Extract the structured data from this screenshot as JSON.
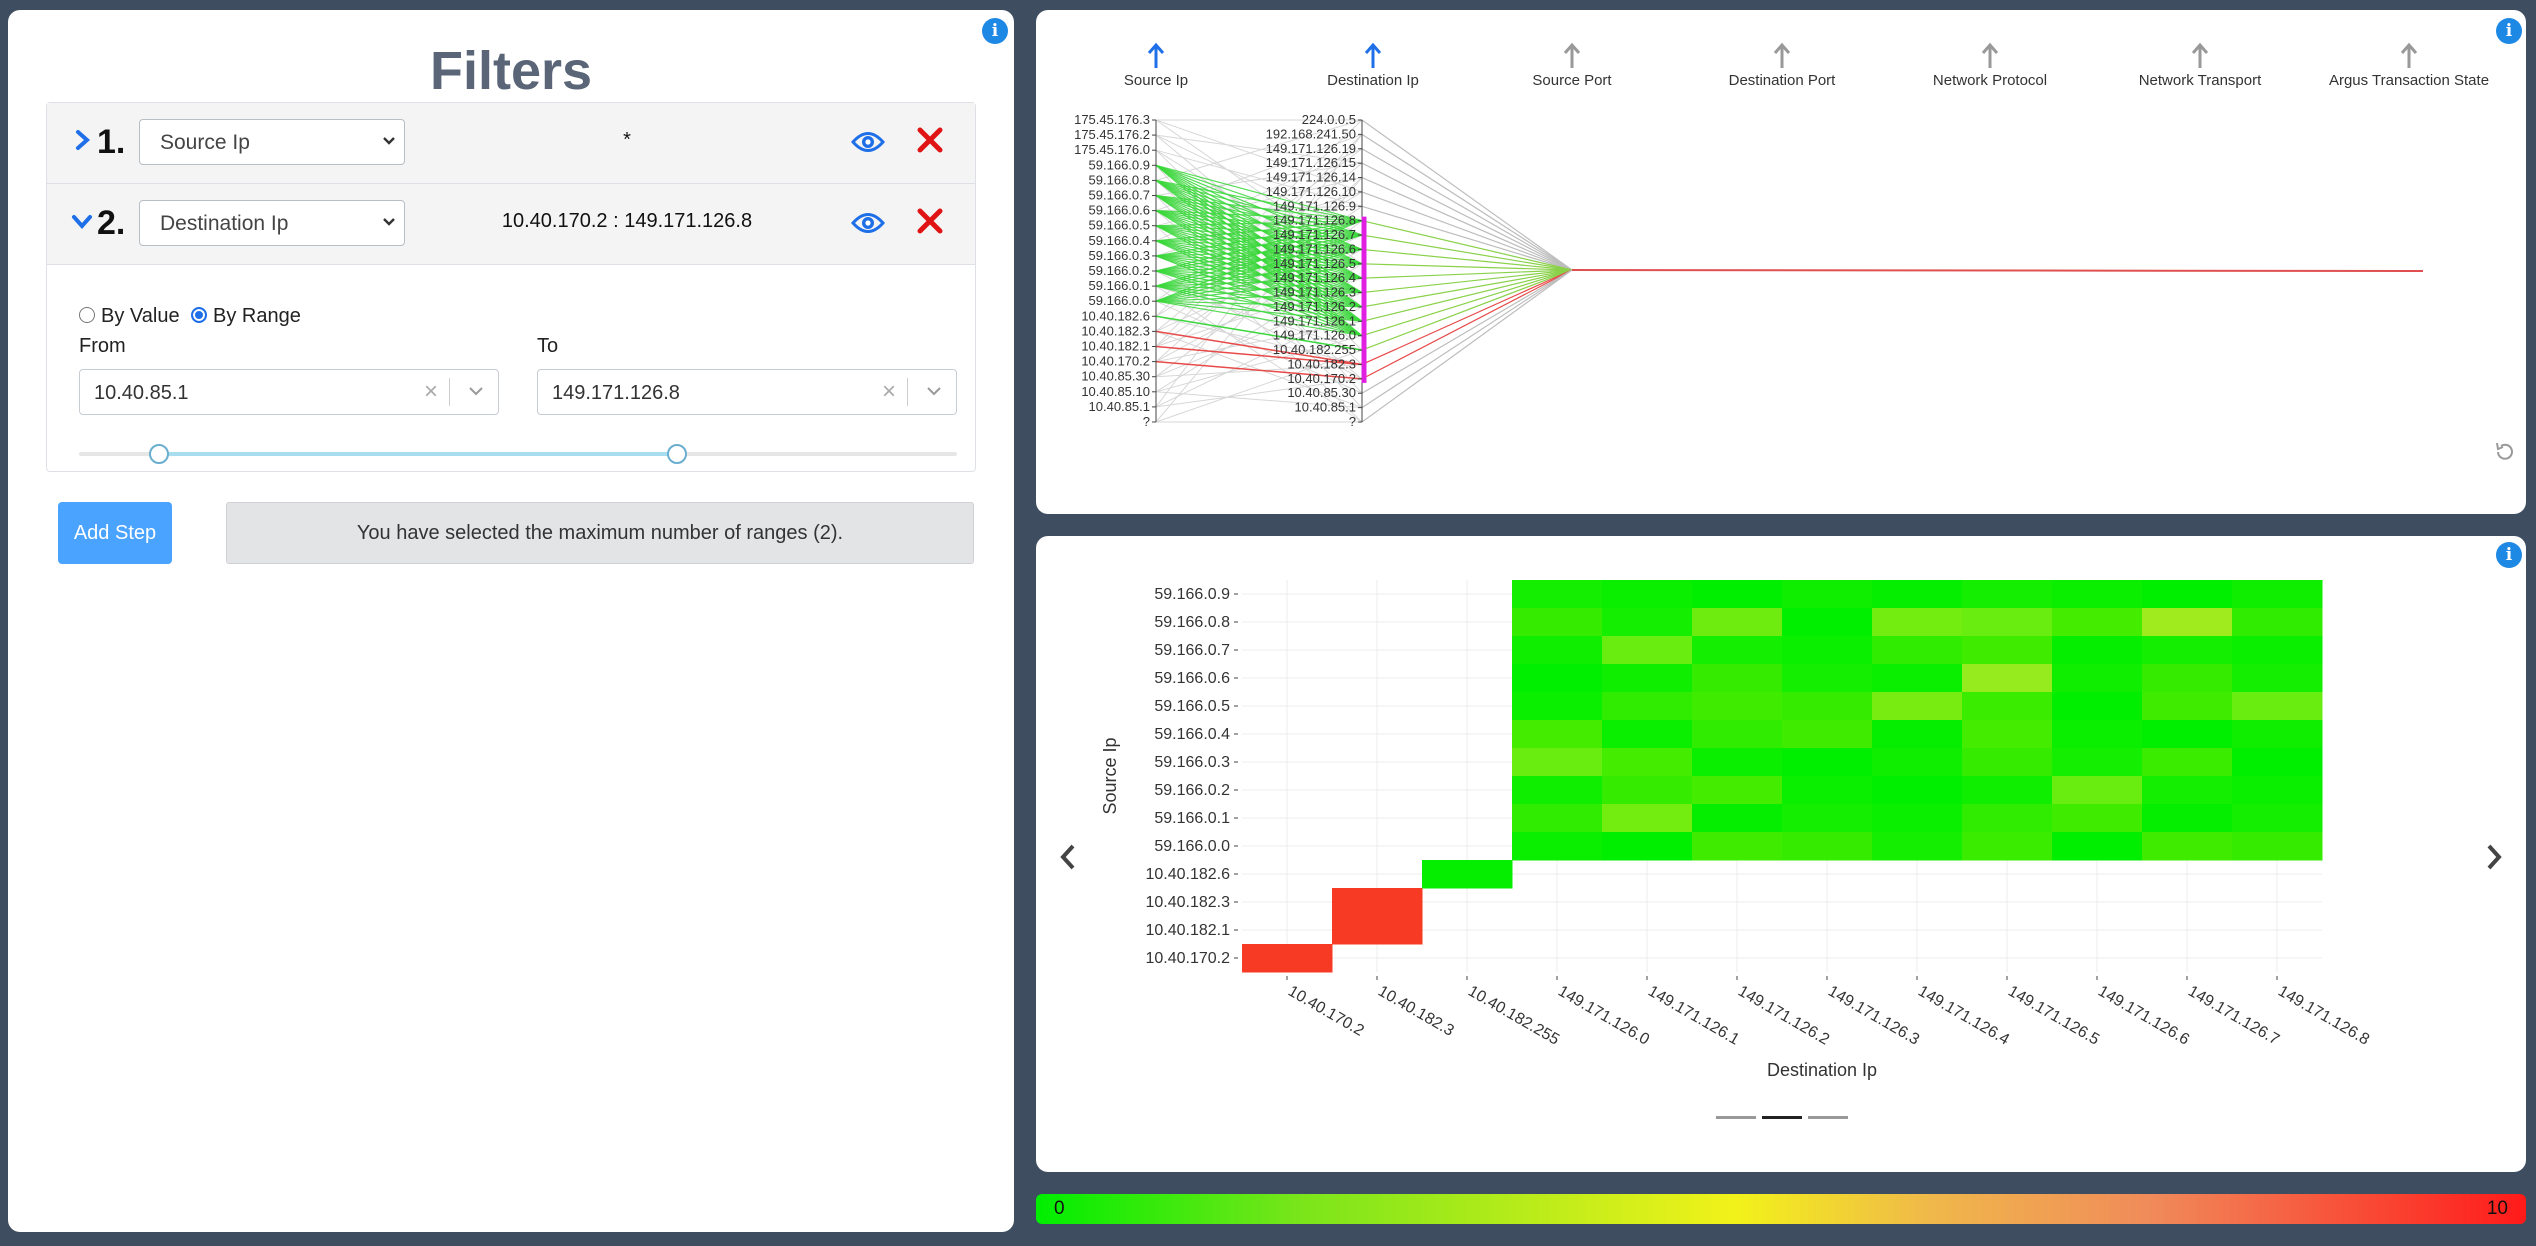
{
  "filters": {
    "title": "Filters",
    "steps": [
      {
        "number": "1.",
        "field": "Source Ip",
        "value": "*",
        "expanded": false
      },
      {
        "number": "2.",
        "field": "Destination Ip",
        "value": "10.40.170.2 : 149.171.126.8",
        "expanded": true
      }
    ],
    "mode": {
      "by_value": "By Value",
      "by_range": "By Range",
      "selected": "By Range"
    },
    "from_label": "From",
    "to_label": "To",
    "from_value": "10.40.85.1",
    "to_value": "149.171.126.8",
    "slider": {
      "low_fraction": 0.09,
      "high_fraction": 0.68
    },
    "add_step": "Add Step",
    "message": "You have selected the maximum number of ranges (2)."
  },
  "parallel": {
    "dimensions": [
      "Source Ip",
      "Destination Ip",
      "Source Port",
      "Destination Port",
      "Network Protocol",
      "Network Transport",
      "Argus Transaction State"
    ],
    "source_ticks": [
      "175.45.176.3",
      "175.45.176.2",
      "175.45.176.0",
      "59.166.0.9",
      "59.166.0.8",
      "59.166.0.7",
      "59.166.0.6",
      "59.166.0.5",
      "59.166.0.4",
      "59.166.0.3",
      "59.166.0.2",
      "59.166.0.1",
      "59.166.0.0",
      "10.40.182.6",
      "10.40.182.3",
      "10.40.182.1",
      "10.40.170.2",
      "10.40.85.30",
      "10.40.85.10",
      "10.40.85.1",
      "?"
    ],
    "dest_ticks": [
      "224.0.0.5",
      "192.168.241.50",
      "149.171.126.19",
      "149.171.126.15",
      "149.171.126.14",
      "149.171.126.10",
      "149.171.126.9",
      "149.171.126.8",
      "149.171.126.7",
      "149.171.126.6",
      "149.171.126.5",
      "149.171.126.4",
      "149.171.126.3",
      "149.171.126.2",
      "149.171.126.1",
      "149.171.126.0",
      "10.40.182.255",
      "10.40.182.3",
      "10.40.170.2",
      "10.40.85.30",
      "10.40.85.1",
      "?"
    ]
  },
  "heatmap": {
    "ylabel": "Source Ip",
    "xlabel": "Destination Ip",
    "y_ticks": [
      "59.166.0.9",
      "59.166.0.8",
      "59.166.0.7",
      "59.166.0.6",
      "59.166.0.5",
      "59.166.0.4",
      "59.166.0.3",
      "59.166.0.2",
      "59.166.0.1",
      "59.166.0.0",
      "10.40.182.6",
      "10.40.182.3",
      "10.40.182.1",
      "10.40.170.2"
    ],
    "x_ticks": [
      "10.40.170.2",
      "10.40.182.3",
      "10.40.182.255",
      "149.171.126.0",
      "149.171.126.1",
      "149.171.126.2",
      "149.171.126.3",
      "149.171.126.4",
      "149.171.126.5",
      "149.171.126.6",
      "149.171.126.7",
      "149.171.126.8"
    ],
    "prev_icon": "chevron-left-icon",
    "next_icon": "chevron-right-icon"
  },
  "chart_data": {
    "type": "heatmap",
    "xlabel": "Destination Ip",
    "ylabel": "Source Ip",
    "x": [
      "10.40.170.2",
      "10.40.182.3",
      "10.40.182.255",
      "149.171.126.0",
      "149.171.126.1",
      "149.171.126.2",
      "149.171.126.3",
      "149.171.126.4",
      "149.171.126.5",
      "149.171.126.6",
      "149.171.126.7",
      "149.171.126.8"
    ],
    "y": [
      "59.166.0.9",
      "59.166.0.8",
      "59.166.0.7",
      "59.166.0.6",
      "59.166.0.5",
      "59.166.0.4",
      "59.166.0.3",
      "59.166.0.2",
      "59.166.0.1",
      "59.166.0.0",
      "10.40.182.6",
      "10.40.182.3",
      "10.40.182.1",
      "10.40.170.2"
    ],
    "z": [
      [
        null,
        null,
        null,
        0,
        0,
        0,
        0,
        0,
        0,
        0,
        0,
        0
      ],
      [
        null,
        null,
        null,
        1,
        0,
        2,
        0,
        2,
        2,
        1,
        3,
        1
      ],
      [
        null,
        null,
        null,
        0,
        2,
        0,
        0,
        1,
        1,
        0,
        0,
        0
      ],
      [
        null,
        null,
        null,
        0,
        0,
        1,
        0,
        0,
        3,
        0,
        1,
        0
      ],
      [
        null,
        null,
        null,
        0,
        1,
        1,
        1,
        2,
        1,
        0,
        1,
        2
      ],
      [
        null,
        null,
        null,
        1,
        0,
        1,
        1,
        0,
        1,
        0,
        0,
        0
      ],
      [
        null,
        null,
        null,
        2,
        1,
        0,
        0,
        0,
        1,
        0,
        1,
        0
      ],
      [
        null,
        null,
        null,
        0,
        1,
        1,
        0,
        0,
        0,
        2,
        0,
        0
      ],
      [
        null,
        null,
        null,
        1,
        2,
        0,
        0,
        0,
        1,
        1,
        0,
        0
      ],
      [
        null,
        null,
        null,
        0,
        0,
        1,
        1,
        0,
        1,
        0,
        1,
        1
      ],
      [
        null,
        null,
        0,
        null,
        null,
        null,
        null,
        null,
        null,
        null,
        null,
        null
      ],
      [
        null,
        10,
        null,
        null,
        null,
        null,
        null,
        null,
        null,
        null,
        null,
        null
      ],
      [
        null,
        10,
        null,
        null,
        null,
        null,
        null,
        null,
        null,
        null,
        null,
        null
      ],
      [
        10,
        null,
        null,
        null,
        null,
        null,
        null,
        null,
        null,
        null,
        null,
        null
      ]
    ],
    "colorscale": {
      "min": 0,
      "max": 10,
      "low_color": "#00ee00",
      "high_color": "#ff1a1a"
    }
  },
  "colorbar": {
    "min_label": "0",
    "max_label": "10"
  },
  "info_icon": "info-icon"
}
